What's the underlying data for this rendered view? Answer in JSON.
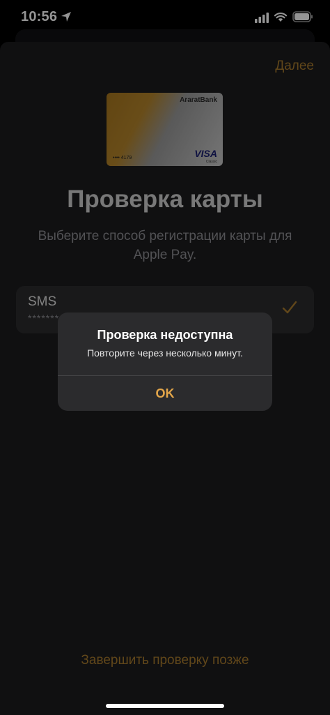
{
  "status_bar": {
    "time": "10:56",
    "icons": [
      "location-arrow-icon",
      "cellular-signal-icon",
      "wifi-icon",
      "battery-icon"
    ]
  },
  "header": {
    "next_label": "Далее"
  },
  "card": {
    "bank_name": "AraratBank",
    "number_masked": "•••• 4179",
    "network": "VISA",
    "tier": "Classic"
  },
  "page": {
    "title": "Проверка карты",
    "subtitle": "Выберите способ регистрации карты для Apple Pay."
  },
  "options": [
    {
      "label": "SMS",
      "detail": "*******",
      "selected": true
    }
  ],
  "footer": {
    "later_label": "Завершить проверку позже"
  },
  "alert": {
    "title": "Проверка недоступна",
    "message": "Повторите через несколько минут.",
    "button": "OK"
  },
  "colors": {
    "accent": "#a87a2d",
    "alert_button": "#e3a64a",
    "sheet_bg": "#1c1c1e",
    "row_bg": "#2c2c2e"
  }
}
